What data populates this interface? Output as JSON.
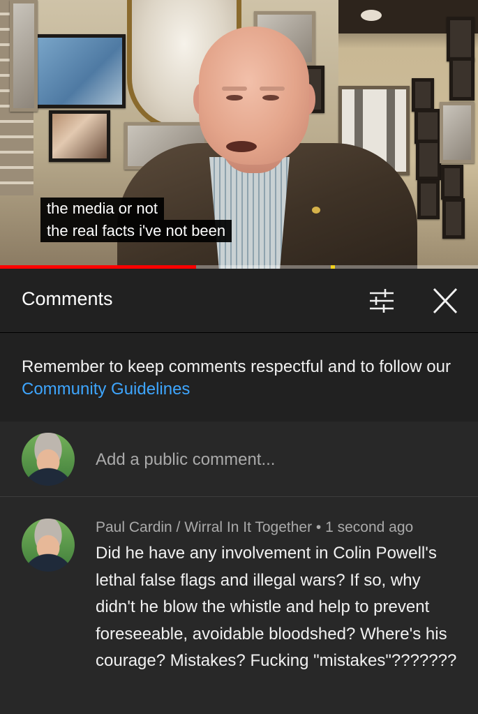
{
  "video": {
    "captions": [
      "the media or not",
      "the real facts i've not been"
    ],
    "progress_percent": 41,
    "colors": {
      "progress": "#ff0000",
      "marker": "#f2d21e"
    }
  },
  "comments_panel": {
    "title": "Comments",
    "filter_icon": "sliders-icon",
    "close_icon": "close-icon",
    "notice_text": "Remember to keep comments respectful and to follow our ",
    "notice_link": "Community Guidelines",
    "add_comment_placeholder": "Add a public comment...",
    "colors": {
      "link": "#3ea6ff",
      "background": "#212121",
      "comment_bg": "#282828"
    }
  },
  "comments": [
    {
      "author": "Paul Cardin / Wirral In It Together",
      "separator": " • ",
      "time": "1 second ago",
      "text": "Did he have any involvement in Colin Powell's lethal false flags and illegal wars? If so, why didn't he blow the whistle and help to prevent foreseeable, avoidable bloodshed? Where's his courage? Mistakes? Fucking \"mistakes\"???????"
    }
  ]
}
